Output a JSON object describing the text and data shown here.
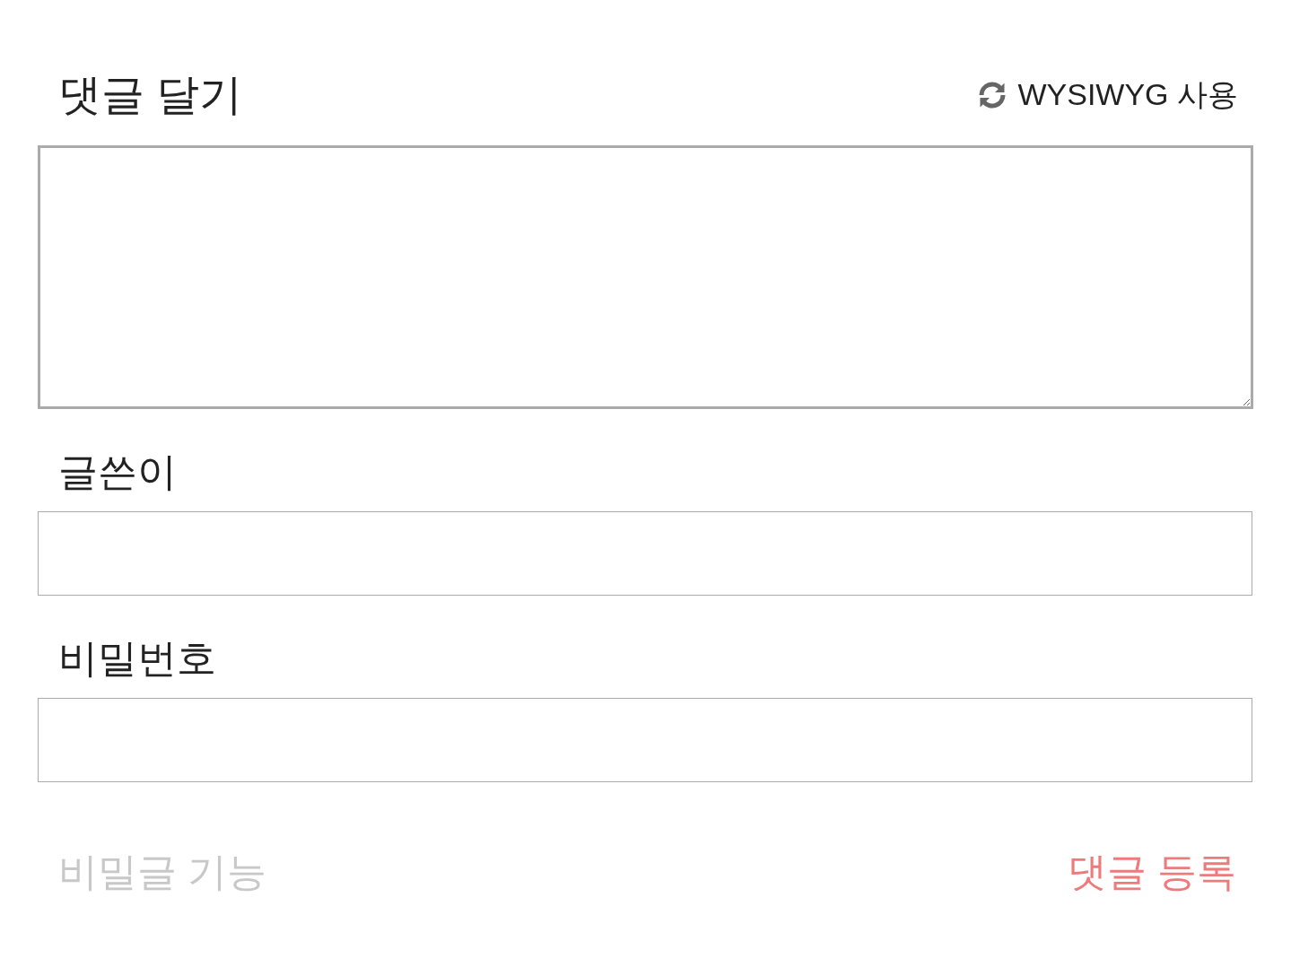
{
  "title": "댓글 달기",
  "editor_toggle": {
    "label": "WYSIWYG 사용"
  },
  "fields": [
    {
      "label": "글쓴이"
    },
    {
      "label": "비밀번호"
    }
  ],
  "secret_option": {
    "label": "비밀글 기능",
    "on": false
  },
  "submit": {
    "label": "댓글 등록"
  }
}
